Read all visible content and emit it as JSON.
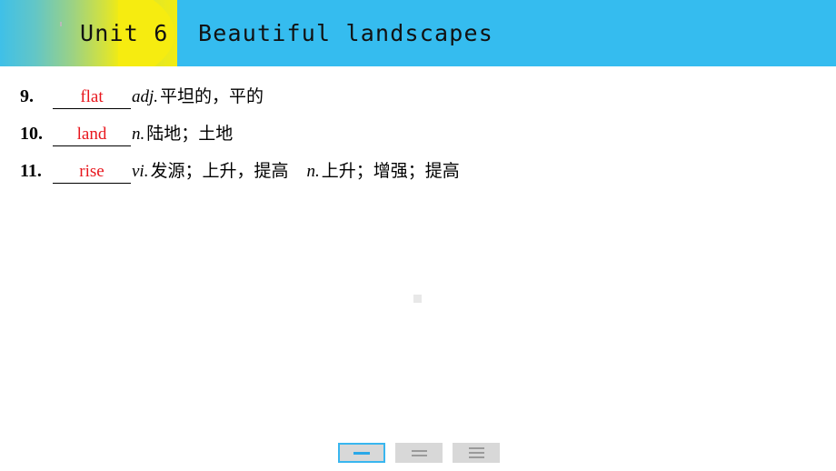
{
  "header": {
    "title": "Unit 6  Beautiful landscapes",
    "unit_label": "Unit 6",
    "topic_label": "Beautiful landscapes",
    "bg_color": "#35bcef",
    "blob_color": "#f6ec10"
  },
  "vocabulary": {
    "items": [
      {
        "number": "9.",
        "answer": "flat",
        "pos": "adj.",
        "definition": "平坦的，平的",
        "pos2": "",
        "definition2": ""
      },
      {
        "number": "10.",
        "answer": "land",
        "pos": "n.",
        "definition": "陆地；土地",
        "pos2": "",
        "definition2": ""
      },
      {
        "number": "11.",
        "answer": "rise",
        "pos": "vi.",
        "definition": "发源；上升，提高",
        "pos2": "n.",
        "definition2": "上升；增强；提高"
      }
    ],
    "answer_color": "#e8161d"
  },
  "view_modes": {
    "selected_index": 0,
    "accent_color": "#39b6ef",
    "buttons": [
      {
        "name": "single-line-view",
        "lines": 1
      },
      {
        "name": "two-line-view",
        "lines": 2
      },
      {
        "name": "three-line-view",
        "lines": 3
      }
    ]
  }
}
